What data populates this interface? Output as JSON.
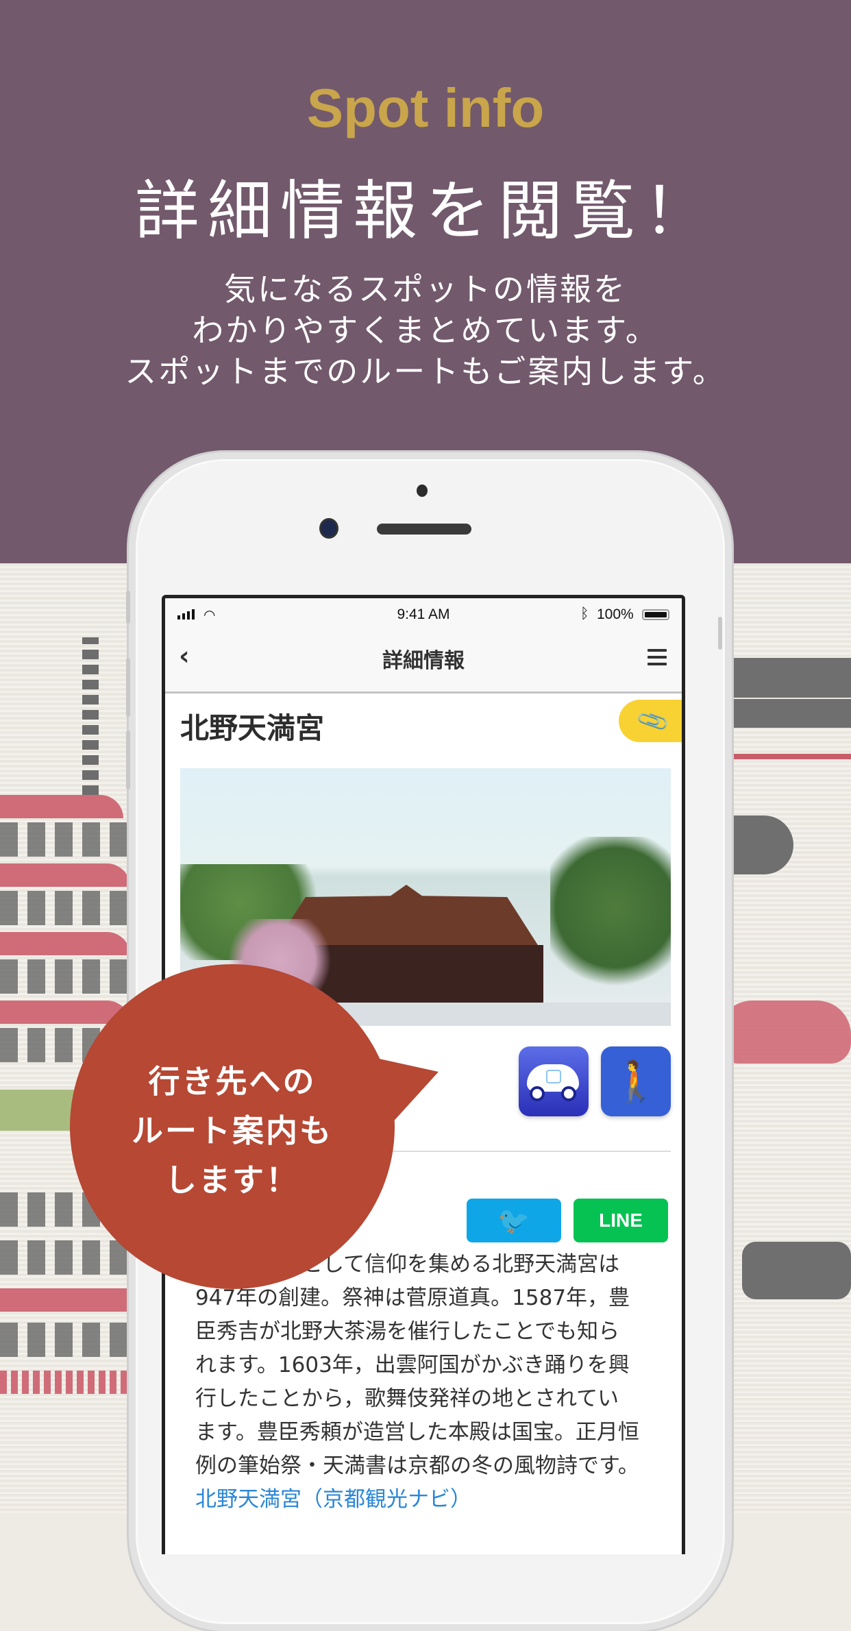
{
  "promo": {
    "title_en": "Spot info",
    "title_jp": "詳細情報を閲覧！",
    "lead_lines": [
      "気になるスポットの情報を",
      "わかりやすくまとめています。",
      "スポットまでのルートもご案内します。"
    ],
    "colors": {
      "header_bg": "#72596c",
      "title_en": "#c9a54b",
      "bubble": "#b64834"
    }
  },
  "statusbar": {
    "signal_icon": "cellular-signal-icon",
    "wifi_icon": "wifi-icon",
    "time": "9:41 AM",
    "bluetooth_icon": "bluetooth-icon",
    "battery_percent": "100%",
    "battery_level": 1.0
  },
  "navbar": {
    "back_icon": "‹",
    "title": "詳細情報",
    "menu_icon": "hamburger-menu-icon"
  },
  "spot": {
    "name": "北野天満宮",
    "clip_icon": "📎",
    "photo_alt": "北野天満宮 本殿",
    "route_buttons": [
      {
        "label": "car-route",
        "icon": "car-icon"
      },
      {
        "label": "walk-route",
        "icon": "🚶"
      }
    ],
    "share": {
      "twitter_icon": "🐦",
      "line_label": "LINE"
    },
    "description_lines": [
      "学問の神様として信仰を集める北野天満宮は",
      "947年の創建。祭神は菅原道真。1587年，豊",
      "臣秀吉が北野大茶湯を催行したことでも知ら",
      "れます。1603年，出雲阿国がかぶき踊りを興",
      "行したことから，歌舞伎発祥の地とされてい",
      "ます。豊臣秀頼が造営した本殿は国宝。正月恒",
      "例の筆始祭・天満書は京都の冬の風物詩です。"
    ],
    "link_text": "北野天満宮（京都観光ナビ）"
  },
  "callout": {
    "lines": [
      "行き先への",
      "ルート案内も",
      "します！"
    ]
  }
}
